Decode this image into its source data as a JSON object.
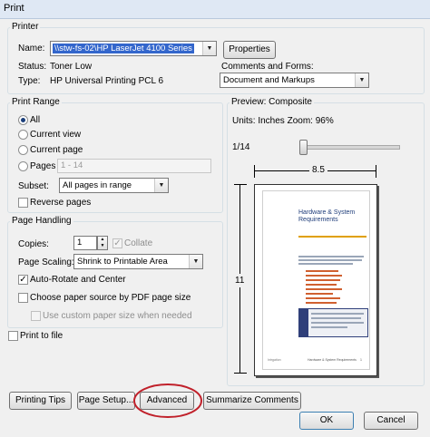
{
  "window": {
    "title": "Print"
  },
  "printer": {
    "group_label": "Printer",
    "name_label": "Name:",
    "name_value": "\\\\stw-fs-02\\HP LaserJet 4100 Series",
    "properties_label": "Properties",
    "status_label": "Status:",
    "status_value": "Toner Low",
    "type_label": "Type:",
    "type_value": "HP Universal Printing PCL 6",
    "comments_label": "Comments and Forms:",
    "comments_value": "Document and Markups"
  },
  "print_range": {
    "group_label": "Print Range",
    "all_label": "All",
    "current_view_label": "Current view",
    "current_page_label": "Current page",
    "pages_label": "Pages",
    "pages_value": "1 - 14",
    "subset_label": "Subset:",
    "subset_value": "All pages in range",
    "reverse_label": "Reverse pages"
  },
  "page_handling": {
    "group_label": "Page Handling",
    "copies_label": "Copies:",
    "copies_value": "1",
    "collate_label": "Collate",
    "scaling_label": "Page Scaling:",
    "scaling_value": "Shrink to Printable Area",
    "auto_rotate_label": "Auto-Rotate and Center",
    "choose_source_label": "Choose paper source by PDF page size",
    "custom_size_label": "Use custom paper size when needed"
  },
  "print_to_file_label": "Print to file",
  "preview": {
    "header": "Preview: Composite",
    "units_zoom": "Units: Inches Zoom: 96%",
    "page_counter": "1/14",
    "slider_fraction": 0.0,
    "width_label": "8.5",
    "height_label": "11",
    "doc_title": "Hardware & System Requirements",
    "doc_footer_right": "Hardware & System Requirements",
    "doc_footer_left": "Intrgation",
    "doc_footer_page": "1"
  },
  "buttons": {
    "printing_tips": "Printing Tips",
    "page_setup": "Page Setup...",
    "advanced": "Advanced",
    "summarize": "Summarize Comments",
    "ok": "OK",
    "cancel": "Cancel"
  },
  "colors": {
    "highlight_circle": "#c0202a",
    "selection_blue": "#3366cc"
  }
}
